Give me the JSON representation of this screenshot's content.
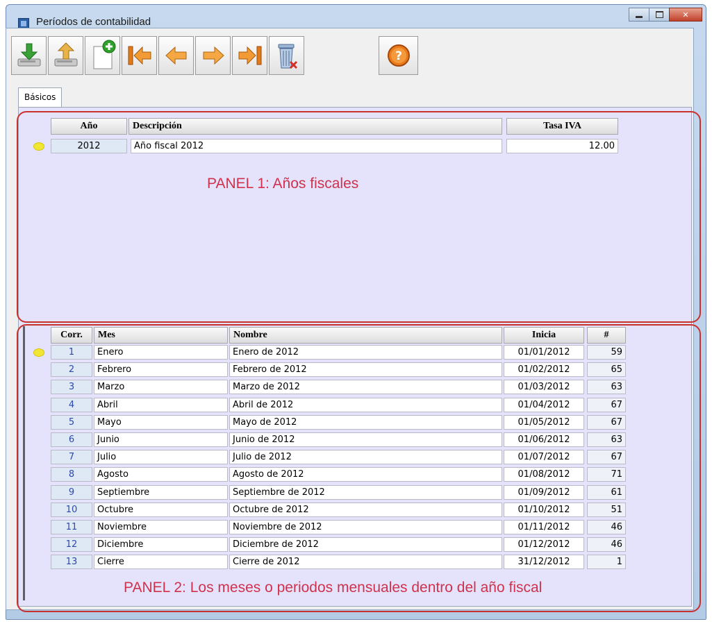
{
  "window": {
    "title": "Períodos de contabilidad"
  },
  "toolbar": {
    "buttons": [
      {
        "name": "download-save-button",
        "icon": "download-icon"
      },
      {
        "name": "upload-button",
        "icon": "upload-icon"
      },
      {
        "name": "new-record-button",
        "icon": "new-document-icon"
      },
      {
        "name": "first-record-button",
        "icon": "arrow-first-icon"
      },
      {
        "name": "previous-record-button",
        "icon": "arrow-left-icon"
      },
      {
        "name": "next-record-button",
        "icon": "arrow-right-icon"
      },
      {
        "name": "last-record-button",
        "icon": "arrow-last-icon"
      },
      {
        "name": "delete-button",
        "icon": "trash-icon"
      }
    ],
    "help_icon": "help-icon"
  },
  "tabs": [
    {
      "label": "Básicos"
    }
  ],
  "panel1": {
    "label": "PANEL 1: Años fiscales",
    "headers": {
      "year": "Año",
      "description": "Descripción",
      "vat": "Tasa IVA"
    },
    "row": {
      "year": "2012",
      "description": "Año fiscal 2012",
      "vat": "12.00"
    }
  },
  "panel2": {
    "label": "PANEL 2: Los meses o periodos mensuales dentro del año fiscal",
    "headers": {
      "corr": "Corr.",
      "month": "Mes",
      "name": "Nombre",
      "start": "Inicia",
      "count": "#"
    },
    "rows": [
      {
        "corr": "1",
        "month": "Enero",
        "name": "Enero de 2012",
        "start": "01/01/2012",
        "count": "59"
      },
      {
        "corr": "2",
        "month": "Febrero",
        "name": "Febrero de 2012",
        "start": "01/02/2012",
        "count": "65"
      },
      {
        "corr": "3",
        "month": "Marzo",
        "name": "Marzo de 2012",
        "start": "01/03/2012",
        "count": "63"
      },
      {
        "corr": "4",
        "month": "Abril",
        "name": "Abril de 2012",
        "start": "01/04/2012",
        "count": "67"
      },
      {
        "corr": "5",
        "month": "Mayo",
        "name": "Mayo de 2012",
        "start": "01/05/2012",
        "count": "67"
      },
      {
        "corr": "6",
        "month": "Junio",
        "name": "Junio de 2012",
        "start": "01/06/2012",
        "count": "63"
      },
      {
        "corr": "7",
        "month": "Julio",
        "name": "Julio de 2012",
        "start": "01/07/2012",
        "count": "67"
      },
      {
        "corr": "8",
        "month": "Agosto",
        "name": "Agosto de 2012",
        "start": "01/08/2012",
        "count": "71"
      },
      {
        "corr": "9",
        "month": "Septiembre",
        "name": "Septiembre de 2012",
        "start": "01/09/2012",
        "count": "61"
      },
      {
        "corr": "10",
        "month": "Octubre",
        "name": "Octubre de 2012",
        "start": "01/10/2012",
        "count": "51"
      },
      {
        "corr": "11",
        "month": "Noviembre",
        "name": "Noviembre de 2012",
        "start": "01/11/2012",
        "count": "46"
      },
      {
        "corr": "12",
        "month": "Diciembre",
        "name": "Diciembre de 2012",
        "start": "01/12/2012",
        "count": "46"
      },
      {
        "corr": "13",
        "month": "Cierre",
        "name": "Cierre de 2012",
        "start": "31/12/2012",
        "count": "1"
      }
    ]
  },
  "colors": {
    "panel_bg": "#e5e3fc",
    "outline": "#c9312f",
    "label": "#d0314c",
    "marker": "#f2e635"
  }
}
